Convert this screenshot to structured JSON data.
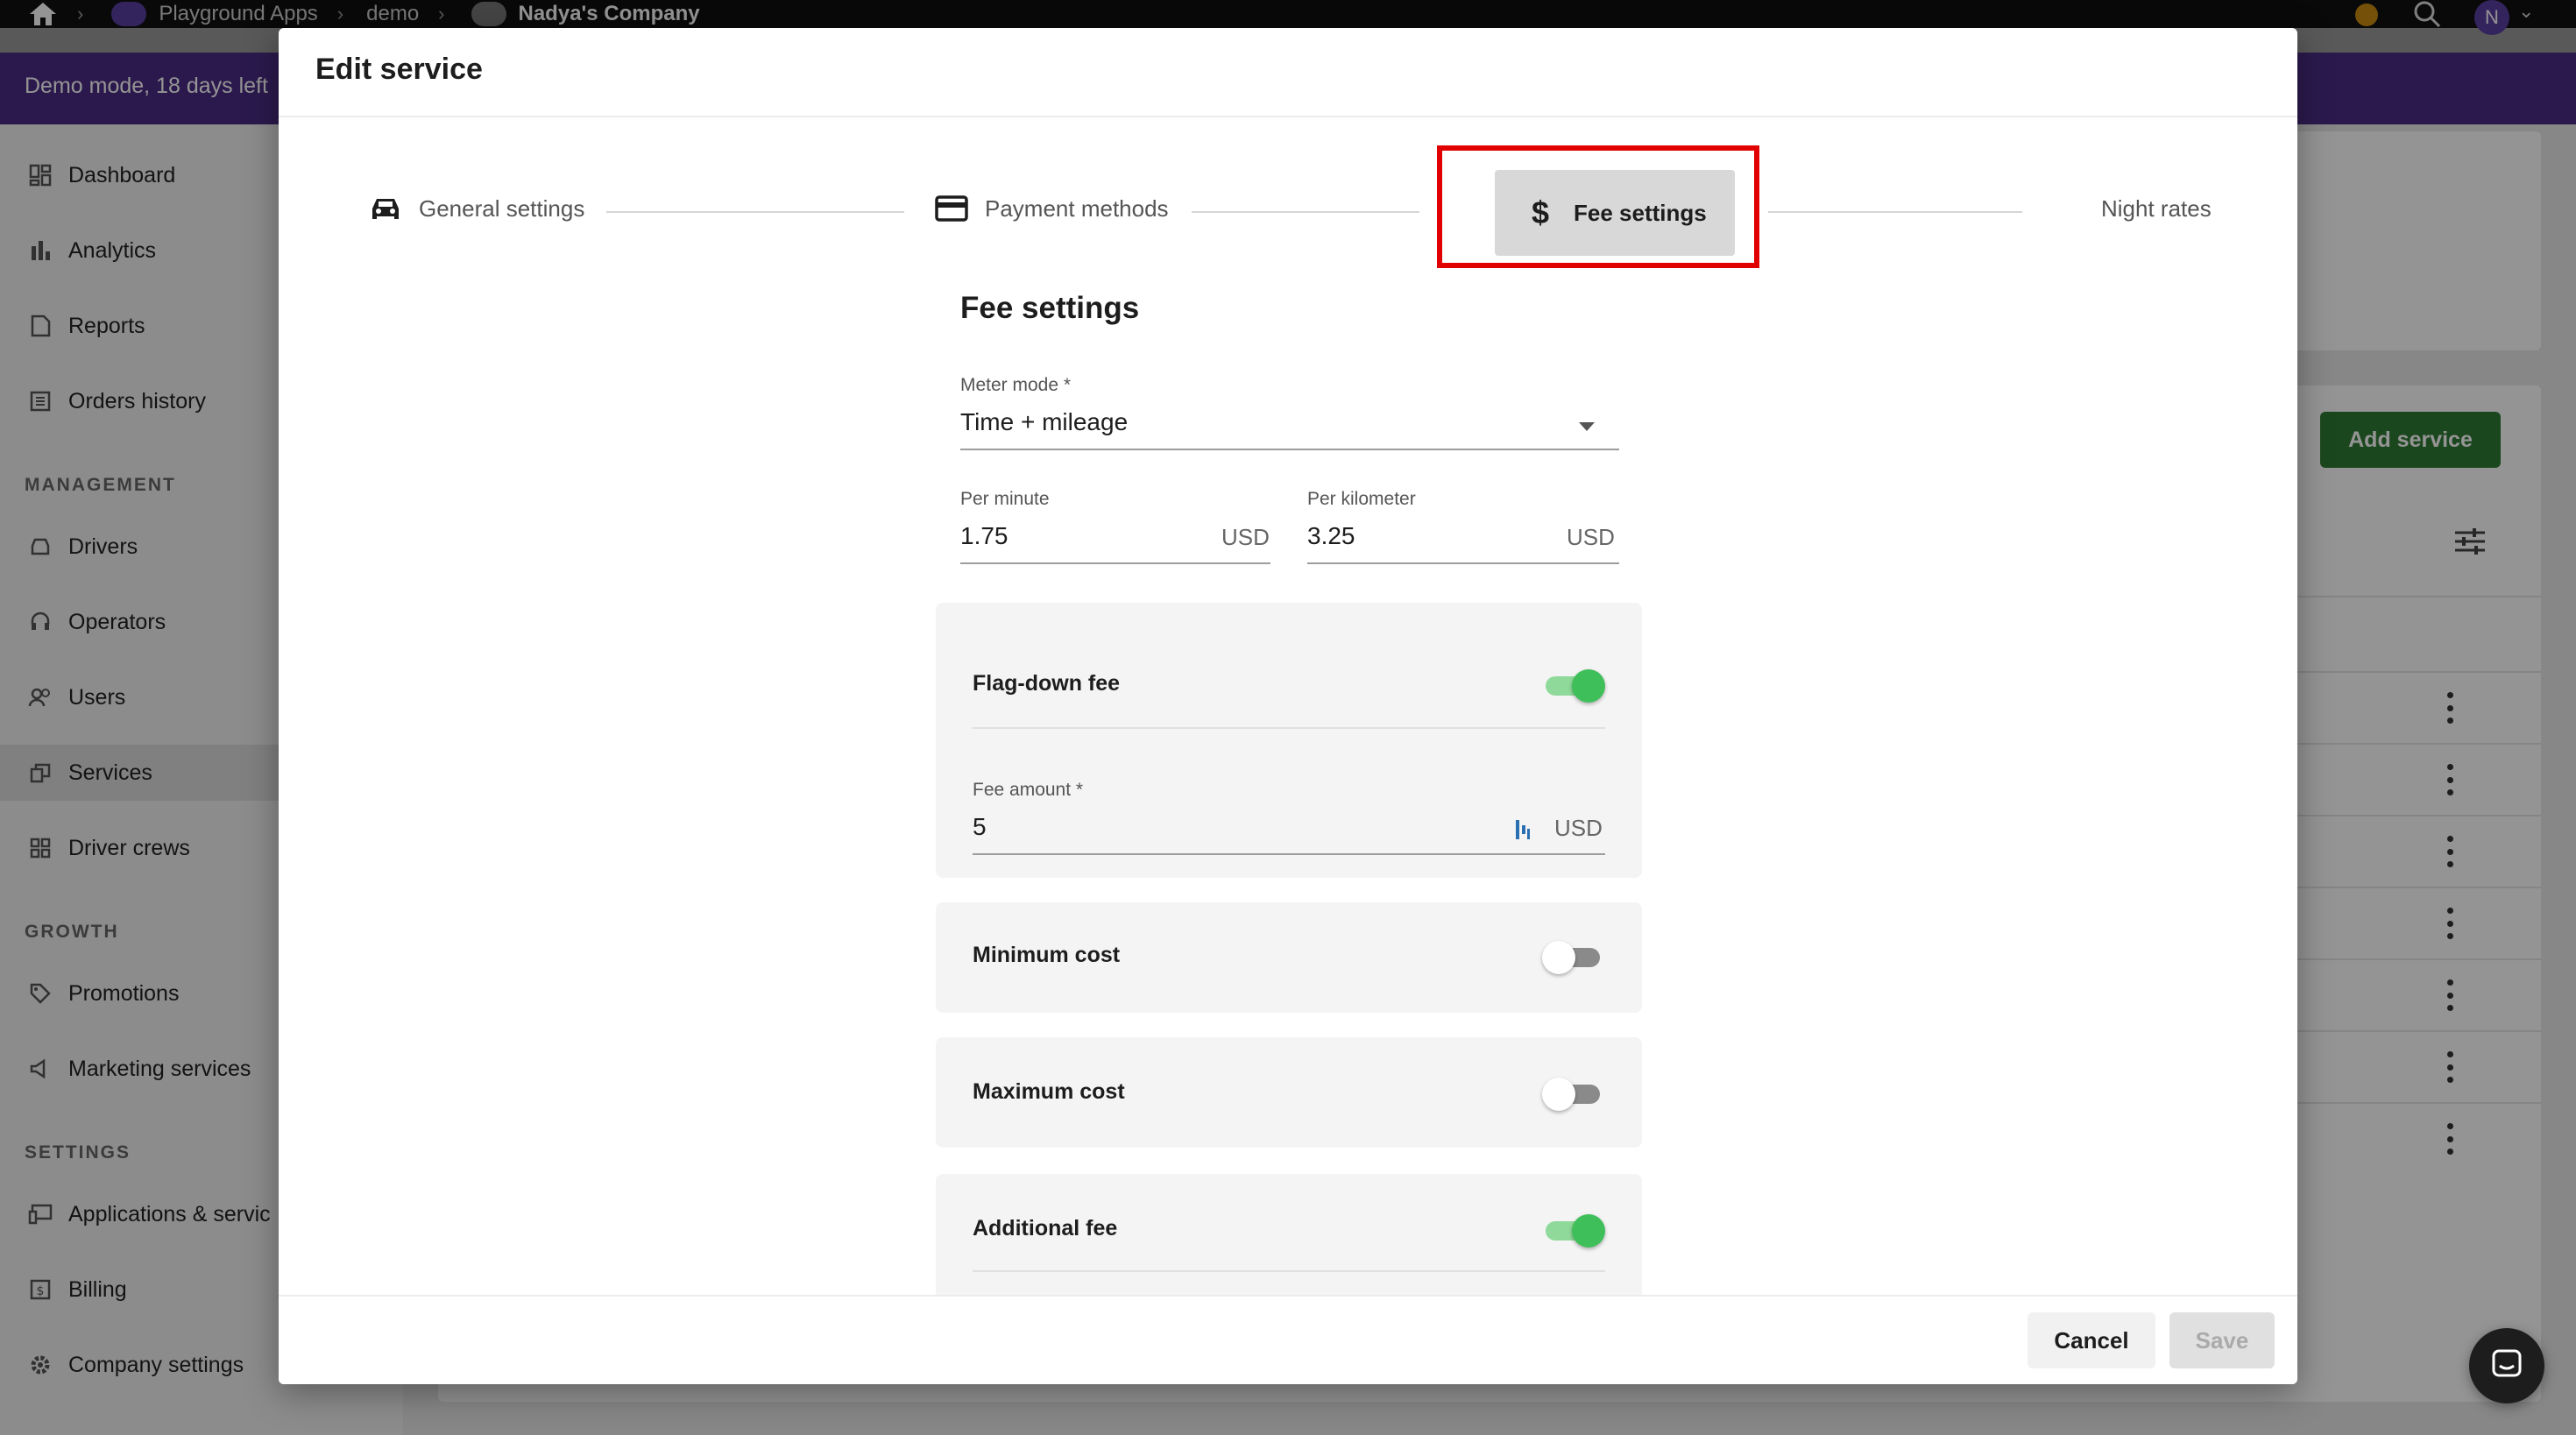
{
  "topbar": {
    "breadcrumbs": [
      "Playground Apps",
      "demo",
      "Nadya's Company"
    ],
    "avatar_letter": "N"
  },
  "banner": {
    "text": "Demo mode, 18 days left"
  },
  "sidebar": {
    "items": [
      {
        "label": "Dashboard",
        "icon": "dashboard-icon"
      },
      {
        "label": "Analytics",
        "icon": "analytics-icon"
      },
      {
        "label": "Reports",
        "icon": "reports-icon"
      },
      {
        "label": "Orders history",
        "icon": "orders-history-icon"
      }
    ],
    "management_header": "MANAGEMENT",
    "management_items": [
      {
        "label": "Drivers",
        "icon": "car-icon"
      },
      {
        "label": "Operators",
        "icon": "headset-icon"
      },
      {
        "label": "Users",
        "icon": "users-icon"
      },
      {
        "label": "Services",
        "icon": "services-icon"
      },
      {
        "label": "Driver crews",
        "icon": "driver-crews-icon"
      }
    ],
    "growth_header": "GROWTH",
    "growth_items": [
      {
        "label": "Promotions",
        "icon": "tag-icon"
      },
      {
        "label": "Marketing services",
        "icon": "megaphone-icon"
      }
    ],
    "settings_header": "SETTINGS",
    "settings_items": [
      {
        "label": "Applications & servic",
        "icon": "devices-icon"
      },
      {
        "label": "Billing",
        "icon": "billing-icon"
      },
      {
        "label": "Company settings",
        "icon": "gear-icon"
      }
    ]
  },
  "main": {
    "add_service_label": "Add service"
  },
  "dialog": {
    "title": "Edit service",
    "steps": [
      {
        "label": "General settings",
        "icon": "car-icon"
      },
      {
        "label": "Payment methods",
        "icon": "credit-card-icon"
      },
      {
        "label": "Fee settings",
        "icon": "dollar-icon",
        "active": true
      },
      {
        "label": "Night rates",
        "icon": "moon-icon"
      }
    ],
    "section_title": "Fee settings",
    "meter_mode": {
      "label": "Meter mode *",
      "value": "Time + mileage"
    },
    "per_minute": {
      "label": "Per minute",
      "value": "1.75",
      "unit": "USD"
    },
    "per_kilometer": {
      "label": "Per kilometer",
      "value": "3.25",
      "unit": "USD"
    },
    "flag_down": {
      "title": "Flag-down fee",
      "enabled": true,
      "amount_label": "Fee amount *",
      "amount_value": "5",
      "unit": "USD"
    },
    "minimum_cost": {
      "title": "Minimum cost",
      "enabled": false
    },
    "maximum_cost": {
      "title": "Maximum cost",
      "enabled": false
    },
    "additional_fee": {
      "title": "Additional fee",
      "enabled": true
    },
    "cancel_label": "Cancel",
    "save_label": "Save"
  },
  "colors": {
    "brand_purple": "#4b2b86",
    "toggle_on": "#3fbf5a",
    "add_service_green": "#2f7a34",
    "highlight_red": "#e00000"
  }
}
